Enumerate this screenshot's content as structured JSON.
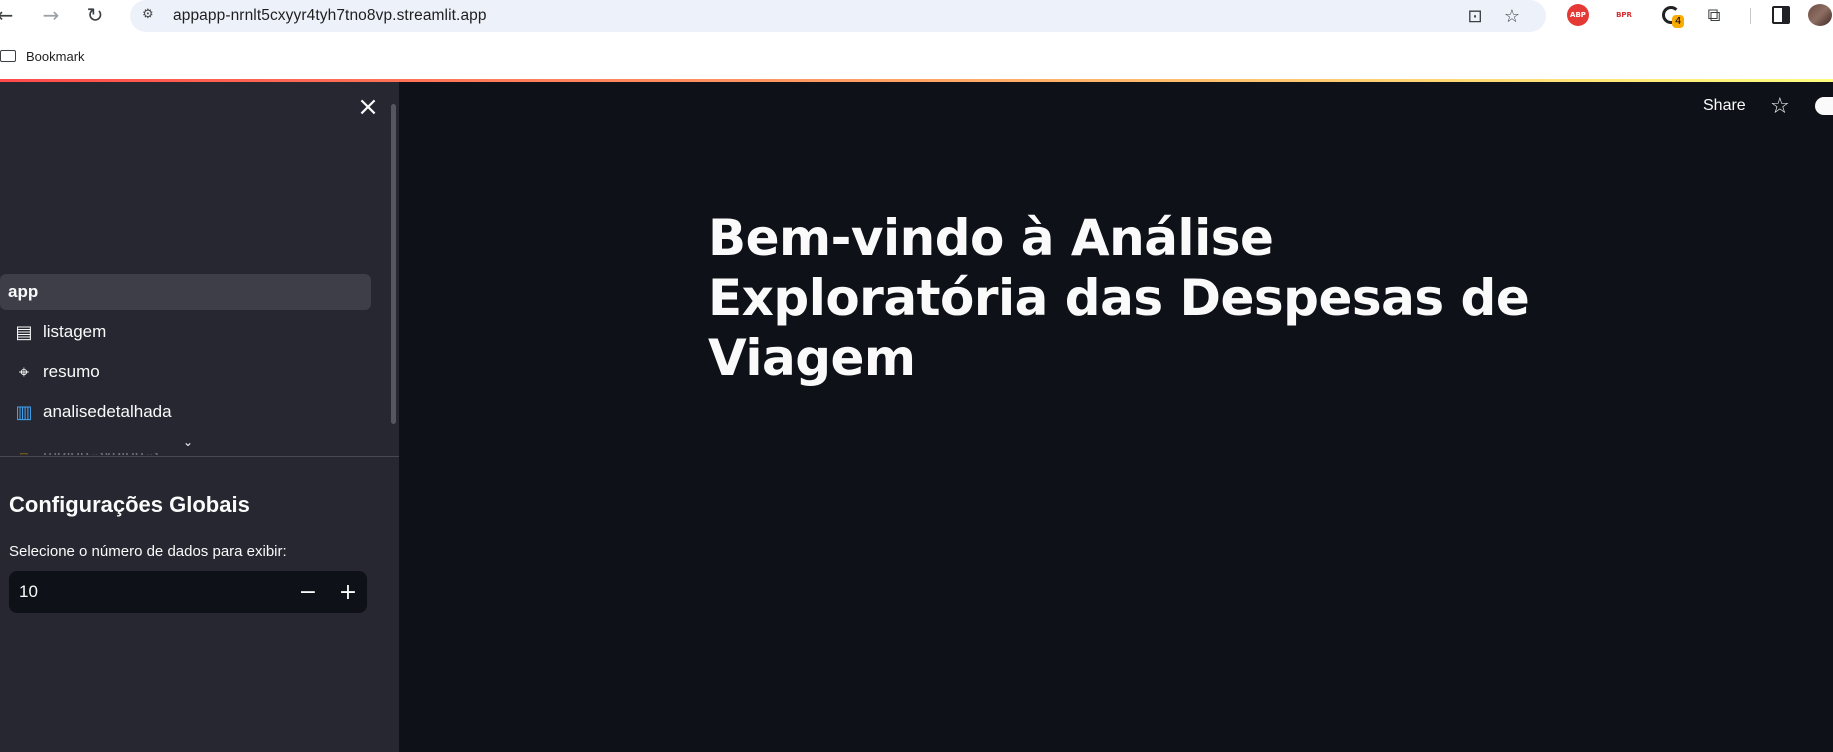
{
  "browser": {
    "url": "appapp-nrnlt5cxyyr4tyh7tno8vp.streamlit.app",
    "bookmark": "Bookmark",
    "extensions": {
      "abp_label": "ABP",
      "bpr_label": "BPR",
      "ring_badge": "4"
    }
  },
  "sidebar": {
    "nav": [
      {
        "label": "app",
        "icon": ""
      },
      {
        "label": "listagem",
        "icon": "page-icon"
      },
      {
        "label": "resumo",
        "icon": "telescope-icon"
      },
      {
        "label": "analisedetalhada",
        "icon": "bar-chart-icon"
      },
      {
        "label": "maioresvalores",
        "icon": "trophy-icon"
      }
    ],
    "heading": "Configurações Globais",
    "input_label": "Selecione o número de dados para exibir:",
    "input_value": "10"
  },
  "main": {
    "share_label": "Share",
    "title": "Bem-vindo à Análise Exploratória das Despesas de Viagem"
  },
  "colors": {
    "app_bg": "#0e1117",
    "sidebar_bg": "#262730",
    "accent": "#ff4b4b"
  }
}
